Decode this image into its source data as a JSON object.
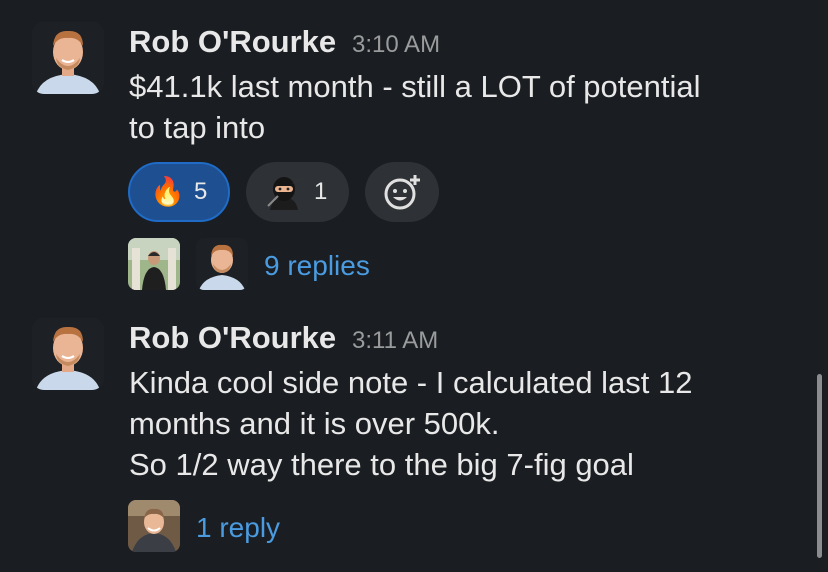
{
  "messages": [
    {
      "author": "Rob O'Rourke",
      "time": "3:10 AM",
      "lines": [
        "$41.1k last month - still a LOT of potential",
        "to tap into"
      ],
      "reactions": [
        {
          "emoji": "🔥",
          "icon": "fire-icon",
          "count": "5",
          "active": true
        },
        {
          "emoji": "",
          "icon": "ninja-icon",
          "count": "1",
          "active": false
        }
      ],
      "add_reaction_icon": "add-emoji-icon",
      "replies": "9 replies"
    },
    {
      "author": "Rob O'Rourke",
      "time": "3:11 AM",
      "lines": [
        "Kinda cool side note - I calculated last 12",
        "months and it is over 500k.",
        "So 1/2 way there to the big 7-fig goal"
      ],
      "replies": "1 reply"
    }
  ],
  "colors": {
    "background": "#1a1d21",
    "active_reaction": "#1d4f91",
    "link": "#4a9be0"
  }
}
